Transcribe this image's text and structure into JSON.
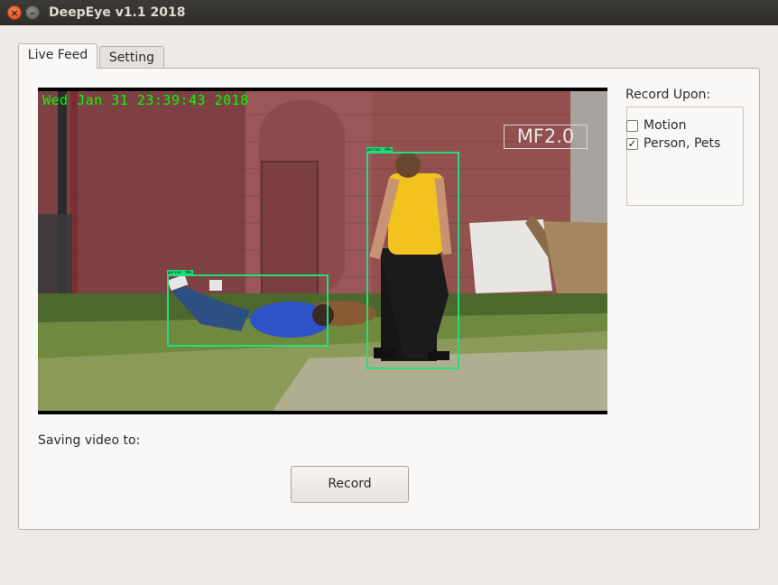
{
  "window": {
    "title": "DeepEye v1.1 2018",
    "close_glyph": "×",
    "minimize_glyph": "–"
  },
  "tabs": [
    {
      "label": "Live Feed",
      "active": true
    },
    {
      "label": "Setting",
      "active": false
    }
  ],
  "video": {
    "timestamp": "Wed Jan 31 23:39:43 2018",
    "watermark": "MF2.0",
    "detections": [
      {
        "label": "person: 98%"
      },
      {
        "label": "person: 99%"
      }
    ],
    "overlay_color": "#00ff00",
    "box_color": "#1fe07a"
  },
  "record_upon": {
    "label": "Record Upon:",
    "options": [
      {
        "label": "Motion",
        "checked": false,
        "mark": ""
      },
      {
        "label": "Person, Pets",
        "checked": true,
        "mark": "✓"
      }
    ]
  },
  "saving_label": "Saving video to:",
  "record_button_label": "Record"
}
